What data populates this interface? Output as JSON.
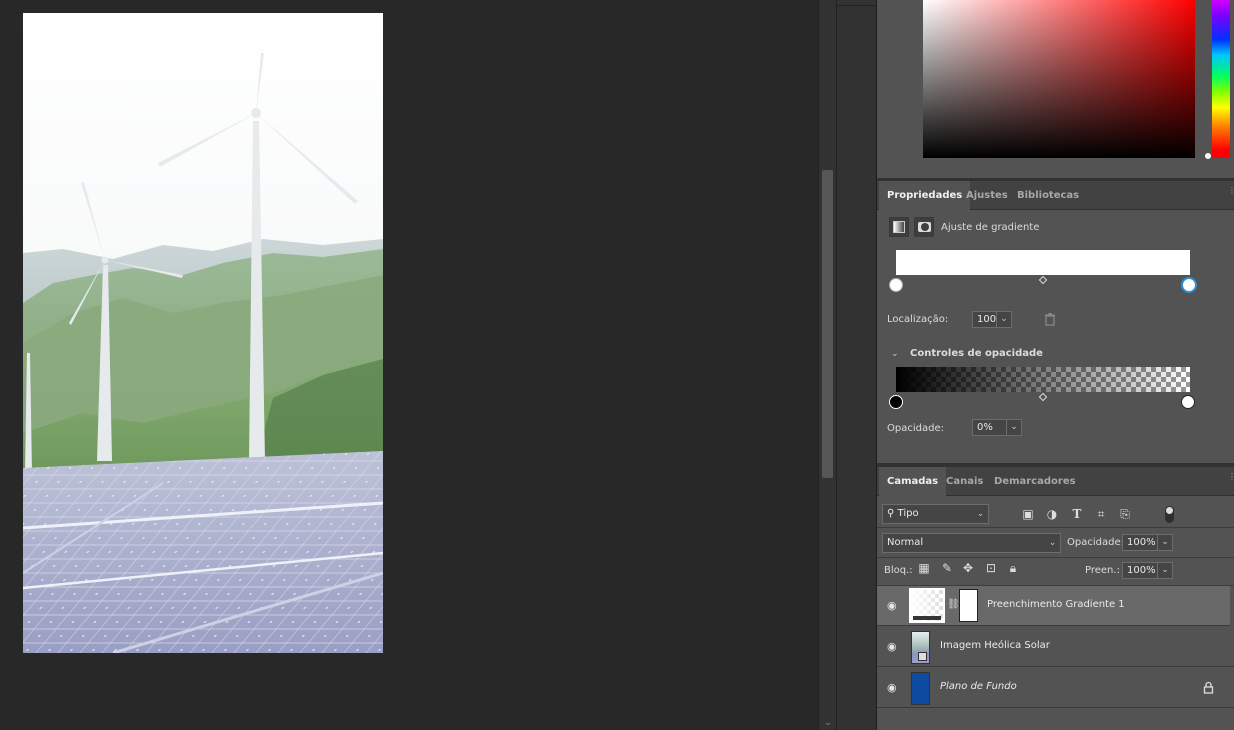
{
  "colors": {
    "panel_bg": "#535353",
    "canvas_bg": "#282828",
    "tab_bar_bg": "#424242",
    "selected_layer_bg": "#696969",
    "background_layer_color": "#0d4aa0",
    "selected_stop_outline": "#2e8fd6"
  },
  "properties_panel": {
    "tabs": [
      {
        "label": "Propriedades",
        "active": true
      },
      {
        "label": "Ajustes",
        "active": false
      },
      {
        "label": "Bibliotecas",
        "active": false
      }
    ],
    "adjustment_title": "Ajuste de gradiente",
    "location_label": "Localização:",
    "location_value": "100",
    "opacity_section_title": "Controles de opacidade",
    "opacity_label": "Opacidade:",
    "opacity_value": "0%"
  },
  "layers_panel": {
    "tabs": [
      {
        "label": "Camadas",
        "active": true
      },
      {
        "label": "Canais",
        "active": false
      },
      {
        "label": "Demarcadores",
        "active": false
      }
    ],
    "filter_kind": "Tipo",
    "blend_mode": "Normal",
    "opacity_label": "Opacidade:",
    "opacity_value": "100%",
    "lock_label": "Bloq.:",
    "fill_label": "Preen.:",
    "fill_value": "100%",
    "layers": [
      {
        "name": "Preenchimento Gradiente 1",
        "selected": true,
        "visible": true
      },
      {
        "name": "Imagem Heólica Solar",
        "selected": false,
        "visible": true
      },
      {
        "name": "Plano de Fundo",
        "selected": false,
        "visible": true,
        "locked": true
      }
    ]
  },
  "icons": {
    "visibility": "eye-icon",
    "lock": "lock-icon",
    "trash": "trash-icon",
    "search": "search-icon",
    "chain": "chain-link-icon"
  }
}
